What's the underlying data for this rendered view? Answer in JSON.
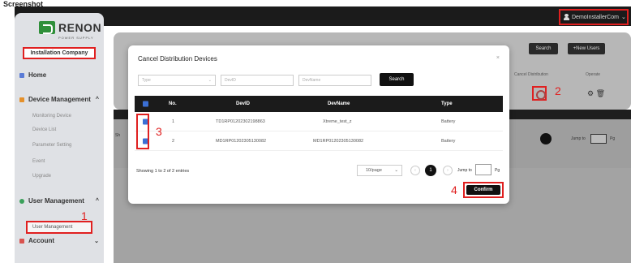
{
  "caption": "Screenshot",
  "user": {
    "name": "DemoInstallerCom"
  },
  "brand": {
    "name": "RENON",
    "tagline": "POWER SUPPLY",
    "company": "Installation Company"
  },
  "sidebar": {
    "home": "Home",
    "device_mgmt": "Device Management",
    "device_sub": [
      "Monitoring Device",
      "Device List",
      "Parameter Setting",
      "Event",
      "Upgrade"
    ],
    "user_mgmt": "User Management",
    "user_sub_active": "User Management",
    "account": "Account"
  },
  "background": {
    "search": "Search",
    "new_users": "+New Users",
    "col_cancel": "Cancel Distribution",
    "col_operate": "Operate",
    "jump": "Jump to",
    "pg": "Pg",
    "page": "1",
    "left_snip": "Sh"
  },
  "modal": {
    "title": "Cancel Distribution Devices",
    "close": "×",
    "filter_type": "Type",
    "filter_devid": "DevID",
    "filter_devname": "DevName",
    "search": "Search",
    "columns": {
      "no": "No.",
      "devid": "DevID",
      "devname": "DevName",
      "type": "Type"
    },
    "rows": [
      {
        "no": "1",
        "devid": "TD1RP01202302198863",
        "devname": "Xtreme_test_z",
        "type": "Battery"
      },
      {
        "no": "2",
        "devid": "MD1RP01202305130082",
        "devname": "MD1RP01202305130082",
        "type": "Battery"
      }
    ],
    "showing": "Showing 1 to 2 of 2 entries",
    "per_page": "10/page",
    "page": "1",
    "jump": "Jump to",
    "pg": "Pg",
    "confirm": "Confirm"
  },
  "steps": [
    "1",
    "2",
    "3",
    "4"
  ],
  "colors": {
    "accent_red": "#e02020",
    "checkbox_blue": "#3b6fd4",
    "brand_green": "#2f8f3a"
  }
}
